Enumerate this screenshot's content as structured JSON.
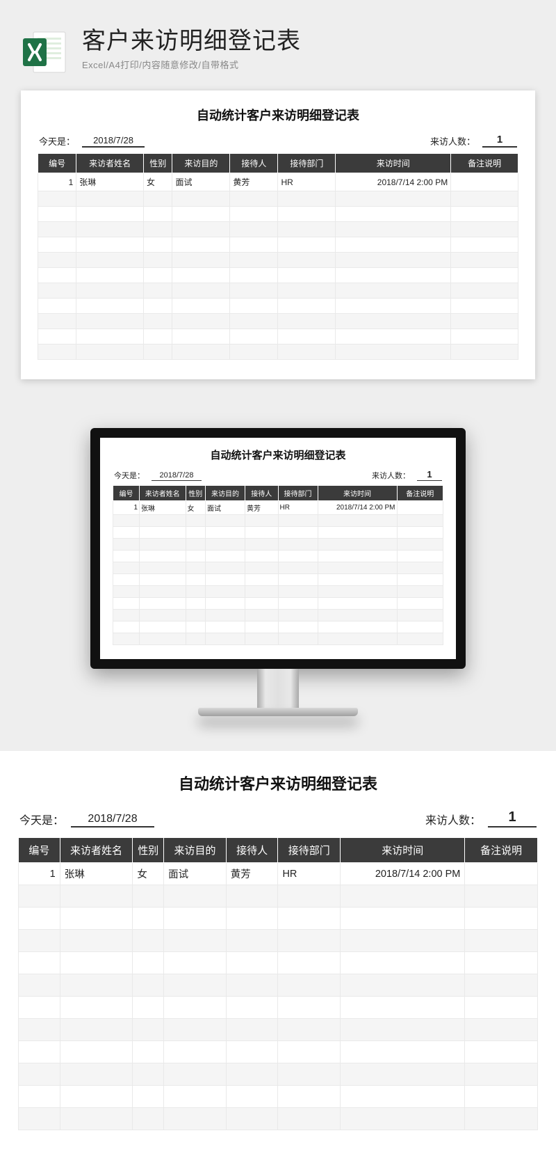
{
  "hero": {
    "title": "客户来访明细登记表",
    "subtitle": "Excel/A4打印/内容随意修改/自带格式"
  },
  "sheet": {
    "title": "自动统计客户来访明细登记表",
    "today_label": "今天是：",
    "today_value": "2018/7/28",
    "count_label": "来访人数：",
    "count_value": "1",
    "headers": {
      "id": "编号",
      "name": "来访者姓名",
      "sex": "性别",
      "purpose": "来访目的",
      "receiver": "接待人",
      "dept": "接待部门",
      "time": "来访时间",
      "note": "备注说明"
    },
    "row": {
      "id": "1",
      "name": "张琳",
      "sex": "女",
      "purpose": "面试",
      "receiver": "黄芳",
      "dept": "HR",
      "time": "2018/7/14 2:00 PM",
      "note": ""
    },
    "blank_rows_card": 11,
    "blank_rows_monitor": 11,
    "blank_rows_big": 11
  }
}
